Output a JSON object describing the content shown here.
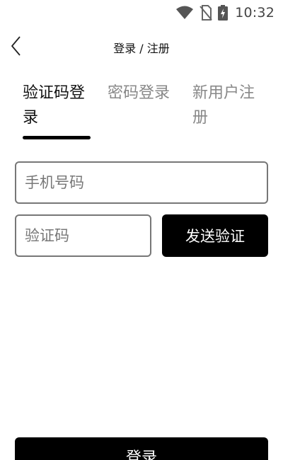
{
  "status_bar": {
    "time": "10:32",
    "icons": [
      "wifi-icon",
      "no-sim-icon",
      "battery-charging-icon"
    ]
  },
  "header": {
    "back_icon": "chevron-left-icon",
    "title": "登录 / 注册"
  },
  "tabs": [
    {
      "label": "验证码登录",
      "active": true
    },
    {
      "label": "密码登录",
      "active": false
    },
    {
      "label": "新用户注册",
      "active": false
    }
  ],
  "form": {
    "phone": {
      "placeholder": "手机号码",
      "value": ""
    },
    "code": {
      "placeholder": "验证码",
      "value": ""
    },
    "send_code_label": "发送验证",
    "login_label": "登录"
  },
  "colors": {
    "primary": "#000000",
    "background": "#ffffff",
    "text": "#111111",
    "muted_text": "#888888",
    "border": "#777777"
  }
}
